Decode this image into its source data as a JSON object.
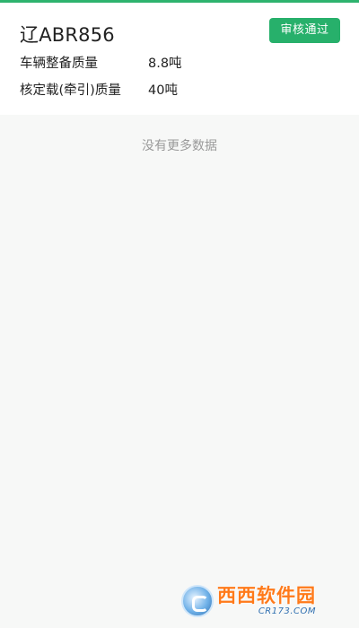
{
  "colors": {
    "accent": "#27b06b",
    "background": "#f7f8f7",
    "card": "#ffffff",
    "muted_text": "#9a9a9a"
  },
  "vehicle": {
    "plate": "辽ABR856",
    "status": "审核通过",
    "fields": [
      {
        "label": "车辆整备质量",
        "value": "8.8吨"
      },
      {
        "label": "核定载(牵引)质量",
        "value": "40吨"
      }
    ]
  },
  "list_footer": {
    "no_more_text": "没有更多数据"
  },
  "watermark": {
    "title": "西西软件园",
    "url": "CR173.COM",
    "logo_icon": "cr173-logo-icon"
  }
}
